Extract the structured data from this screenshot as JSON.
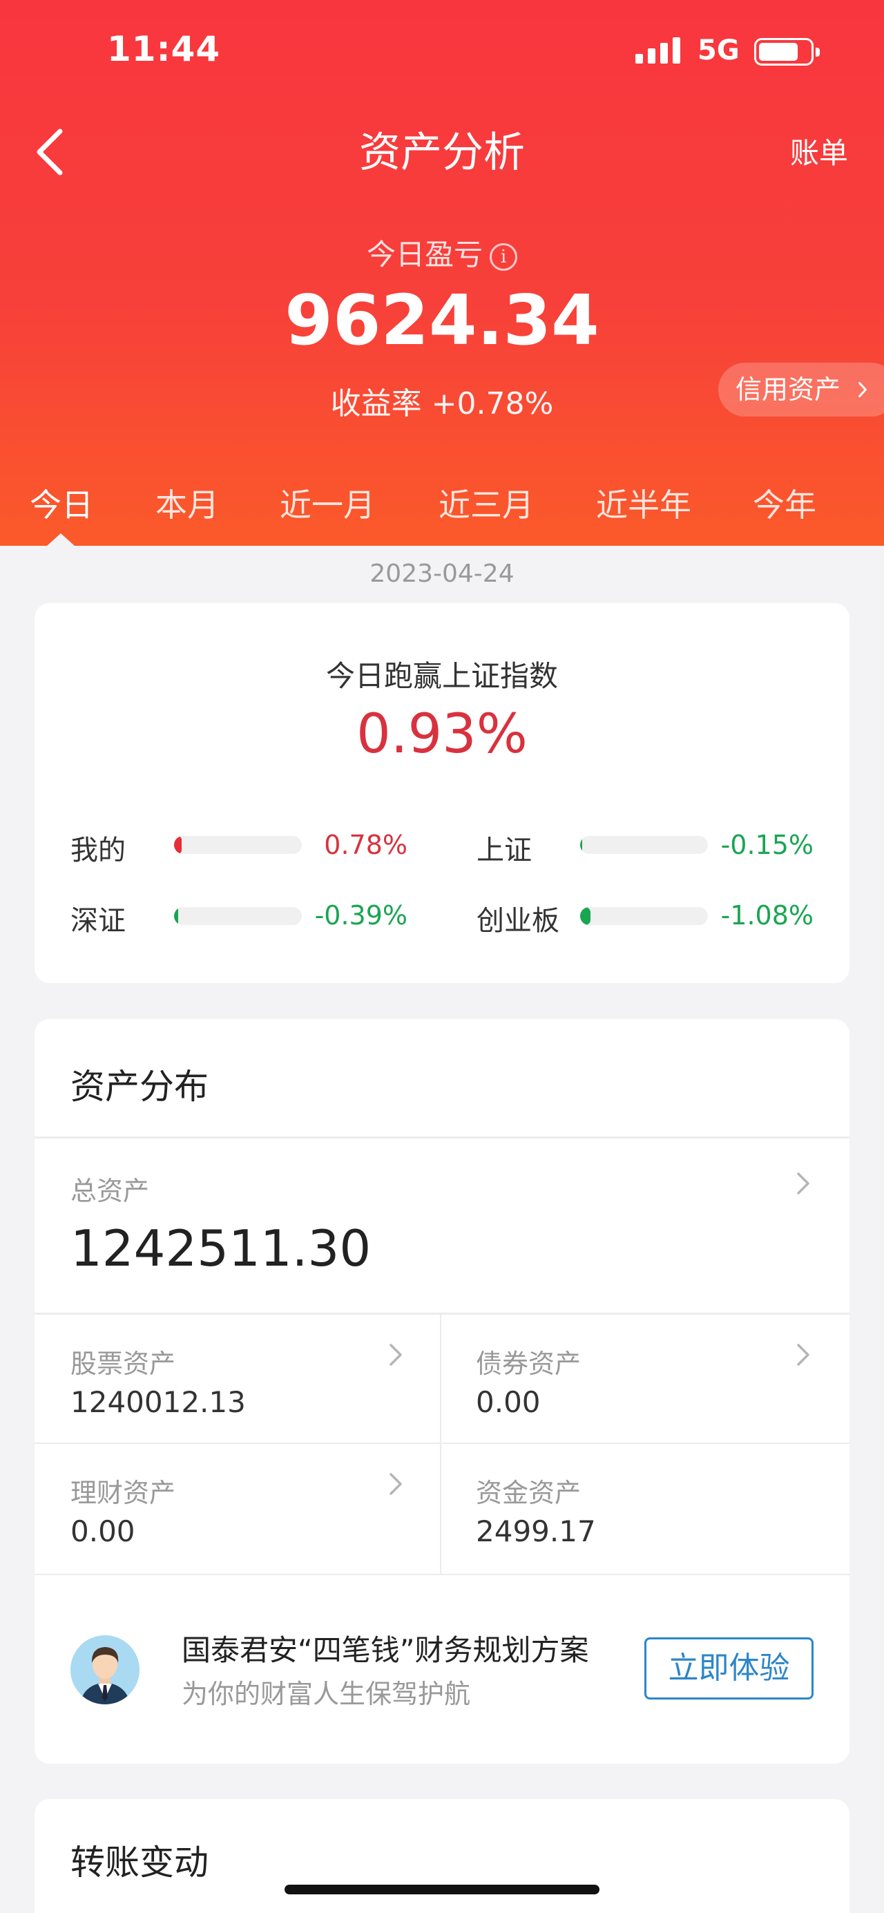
{
  "status_bar": {
    "time": "11:44",
    "network": "5G",
    "battery_level": 0.78
  },
  "nav": {
    "title": "资产分析",
    "bill": "账单",
    "back_icon": "chevron-left-icon"
  },
  "summary": {
    "label": "今日盈亏",
    "info_icon": "i",
    "value": "9624.34",
    "rate": "收益率 +0.78%",
    "credit_button": "信用资产"
  },
  "tabs": [
    {
      "label": "今日",
      "active": true
    },
    {
      "label": "本月",
      "active": false
    },
    {
      "label": "近一月",
      "active": false
    },
    {
      "label": "近三月",
      "active": false
    },
    {
      "label": "近半年",
      "active": false
    },
    {
      "label": "今年",
      "active": false
    }
  ],
  "date": "2023-04-24",
  "beat": {
    "title": "今日跑赢上证指数",
    "value": "0.93%",
    "items": [
      {
        "label": "我的",
        "value": "0.78%",
        "fill": 0.06,
        "color": "#e52e3a"
      },
      {
        "label": "上证",
        "value": "-0.15%",
        "fill": 0.015,
        "color": "#1aa552"
      },
      {
        "label": "深证",
        "value": "-0.39%",
        "fill": 0.03,
        "color": "#1aa552"
      },
      {
        "label": "创业板",
        "value": "-1.08%",
        "fill": 0.08,
        "color": "#1aa552"
      }
    ]
  },
  "assets": {
    "title": "资产分布",
    "total_label": "总资产",
    "total_value": "1242511.30",
    "items": [
      {
        "label": "股票资产",
        "value": "1240012.13",
        "has_arrow": true
      },
      {
        "label": "债券资产",
        "value": "0.00",
        "has_arrow": true
      },
      {
        "label": "理财资产",
        "value": "0.00",
        "has_arrow": true
      },
      {
        "label": "资金资产",
        "value": "2499.17",
        "has_arrow": false
      }
    ],
    "plan": {
      "title": "国泰君安“四笔钱”财务规划方案",
      "subtitle": "为你的财富人生保驾护航",
      "button": "立即体验"
    }
  },
  "transfer": {
    "title": "转账变动"
  },
  "colors": {
    "header_top": "#f8363e",
    "header_bottom": "#fb5a2a",
    "up": "#d8323e",
    "down": "#1aa552",
    "link": "#2c86c8"
  }
}
